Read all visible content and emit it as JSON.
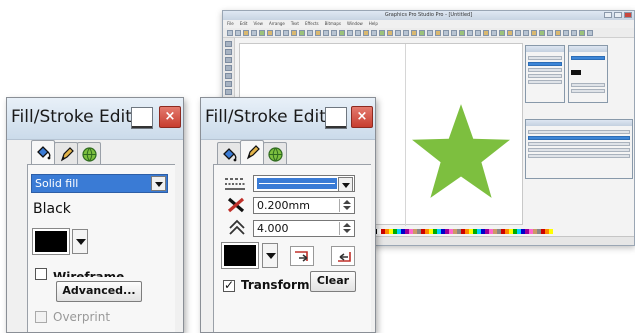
{
  "background_app": {
    "title": "Graphics Pro Studio Pro - [Untitled]",
    "menu": [
      "File",
      "Edit",
      "View",
      "Arrange",
      "Text",
      "Effects",
      "Bitmaps",
      "Window",
      "Help"
    ],
    "star_color": "#7dbf3f"
  },
  "left_panel": {
    "title": "Fill/Stroke Edit",
    "close_glyph": "×",
    "active_tab": "fill",
    "fill_type": "Solid fill",
    "color_name": "Black",
    "swatch_color": "#000000",
    "wireframe_label": "Wireframe",
    "advanced_label": "Advanced...",
    "overprint_label": "Overprint",
    "overprint_checked": false
  },
  "right_panel": {
    "title": "Fill/Stroke Edit",
    "close_glyph": "×",
    "active_tab": "stroke",
    "stroke_width": "0.200mm",
    "miter_limit": "4.000",
    "swatch_color": "#000000",
    "transform_label": "Transform",
    "transform_checked": true,
    "clear_label": "Clear"
  },
  "colors": {
    "accent": "#3a7bd5",
    "close": "#c73d2f",
    "star": "#7dbf3f"
  }
}
